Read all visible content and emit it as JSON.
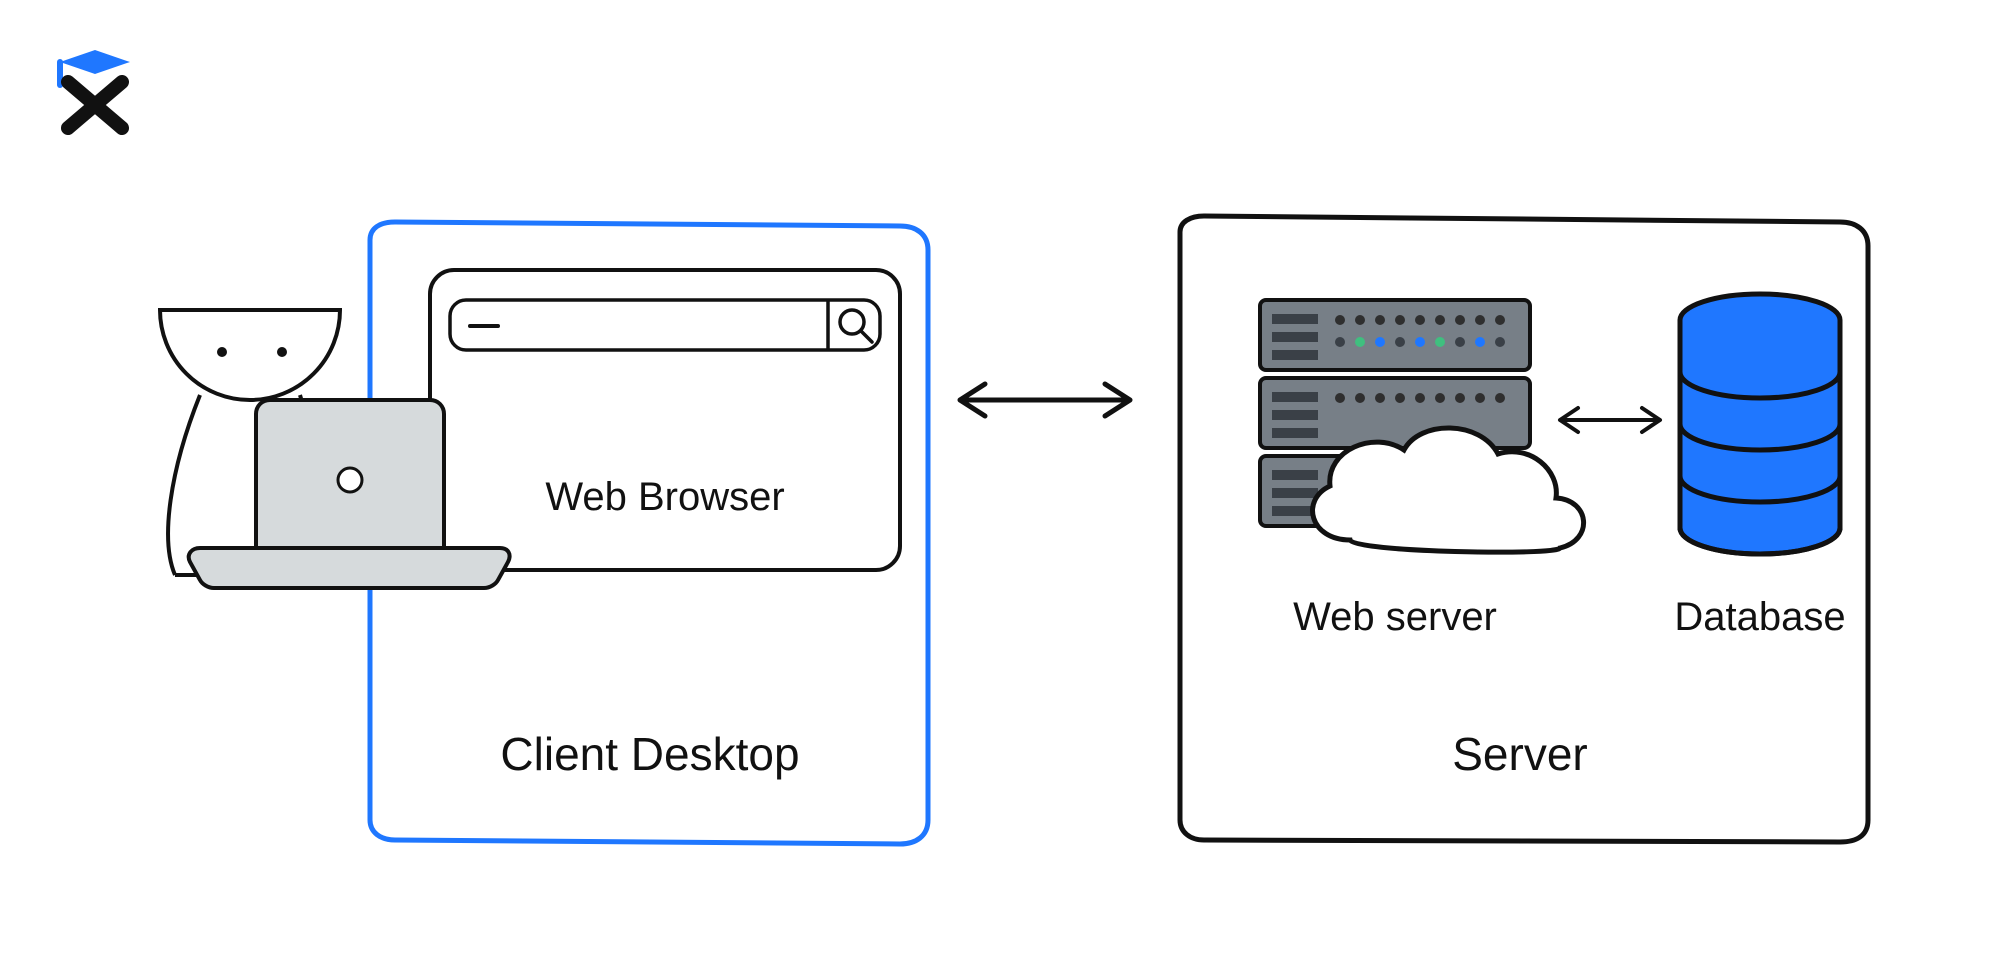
{
  "labels": {
    "client_box": "Client Desktop",
    "browser": "Web Browser",
    "server_box": "Server",
    "web_server": "Web server",
    "database": "Database"
  },
  "colors": {
    "accent_blue": "#1f77ff",
    "db_blue": "#1f77ff",
    "server_gray": "#777f87",
    "laptop_gray": "#d6dadc",
    "outline": "#111111"
  }
}
